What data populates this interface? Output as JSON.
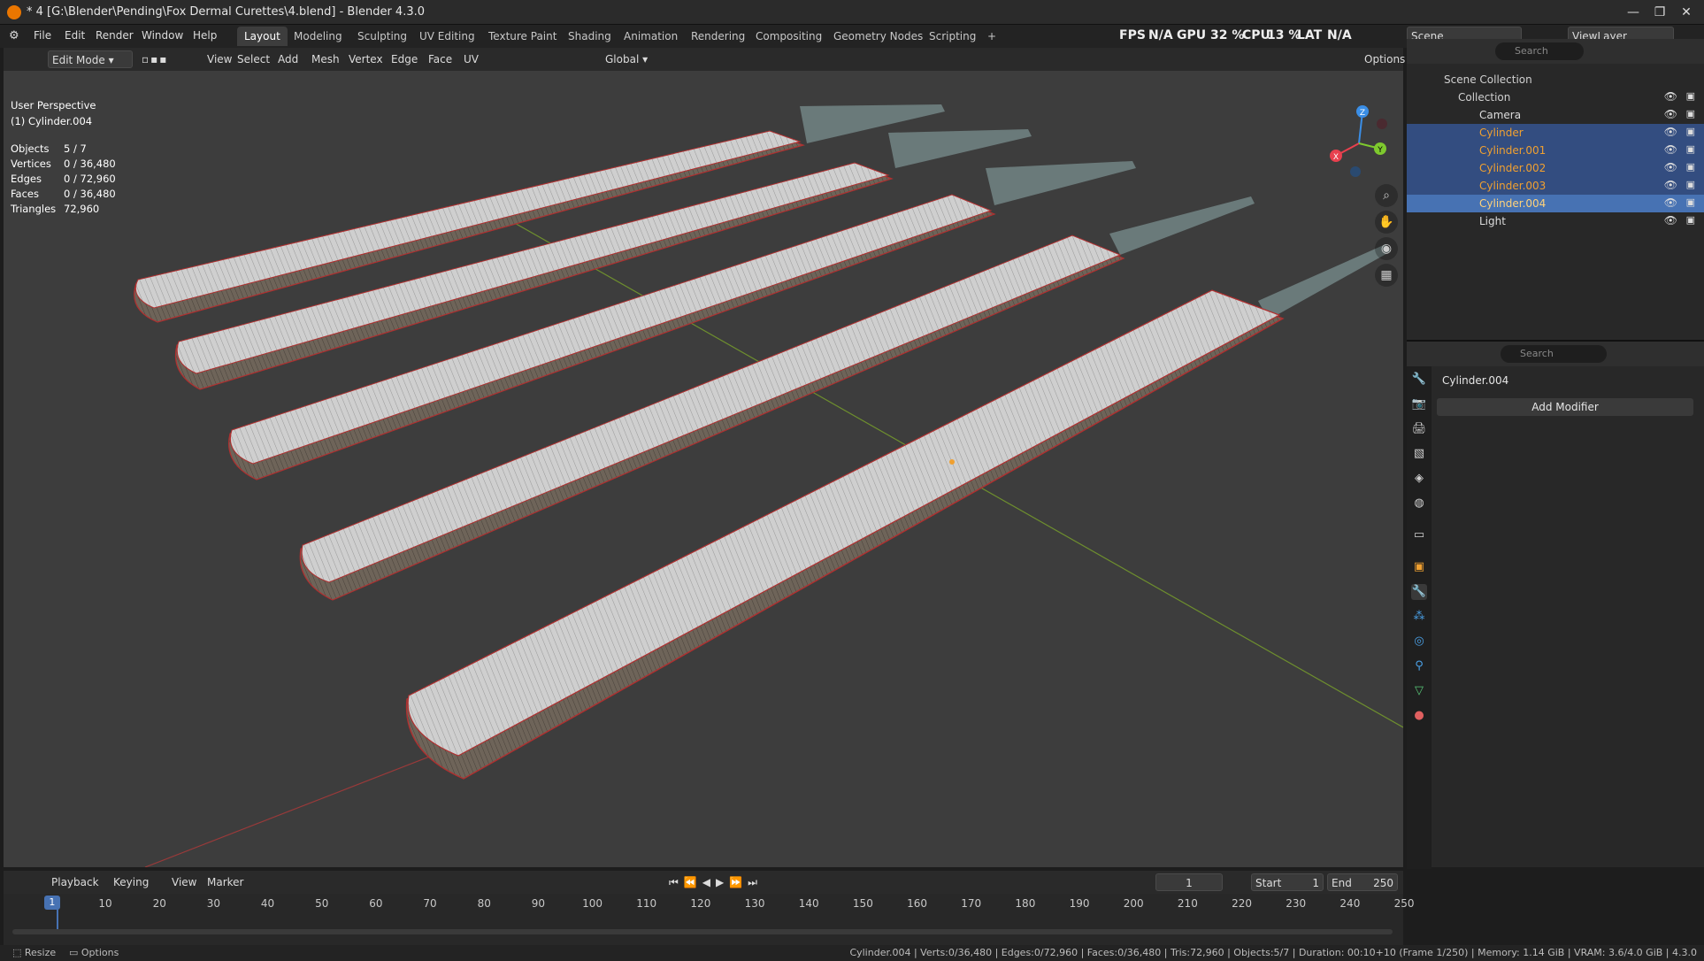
{
  "window": {
    "title": "* 4 [G:\\Blender\\Pending\\Fox Dermal Curettes\\4.blend] - Blender 4.3.0",
    "min": "—",
    "max": "❐",
    "close": "✕"
  },
  "menu": [
    "File",
    "Edit",
    "Render",
    "Window",
    "Help"
  ],
  "workspaces": [
    "Layout",
    "Modeling",
    "Sculpting",
    "UV Editing",
    "Texture Paint",
    "Shading",
    "Animation",
    "Rendering",
    "Compositing",
    "Geometry Nodes",
    "Scripting",
    "+"
  ],
  "stats_bar": {
    "fps_label": "FPS",
    "fps": "N/A",
    "gpu_label": "GPU",
    "gpu": "32 %",
    "cpu_label": "CPU",
    "cpu": "13 %",
    "lat_label": "LAT",
    "lat": "N/A"
  },
  "scene": {
    "label": "Scene",
    "viewlayer": "ViewLayer"
  },
  "viewport_header": {
    "mode": "Edit Mode",
    "menus": [
      "View",
      "Select",
      "Add",
      "Mesh",
      "Vertex",
      "Edge",
      "Face",
      "UV"
    ],
    "transform": "Global",
    "options": "Options",
    "axes": [
      "X",
      "Y",
      "Z"
    ]
  },
  "viewport_overlay": {
    "perspective": "User Perspective",
    "object": "(1) Cylinder.004",
    "stats": [
      {
        "k": "Objects",
        "v": "5 / 7"
      },
      {
        "k": "Vertices",
        "v": "0 / 36,480"
      },
      {
        "k": "Edges",
        "v": "0 / 72,960"
      },
      {
        "k": "Faces",
        "v": "0 / 36,480"
      },
      {
        "k": "Triangles",
        "v": "72,960"
      }
    ]
  },
  "gizmo": {
    "x": "X",
    "y": "Y",
    "z": "Z",
    "colors": {
      "x": "#e8404e",
      "y": "#7ec92e",
      "z": "#3a8ee6"
    }
  },
  "outliner": {
    "search_placeholder": "Search",
    "root": "Scene Collection",
    "collection": "Collection",
    "items": [
      {
        "name": "Camera",
        "color": "#dcdcdc",
        "state": "none"
      },
      {
        "name": "Cylinder",
        "color": "#f0a030",
        "state": "sel"
      },
      {
        "name": "Cylinder.001",
        "color": "#f0a030",
        "state": "sel"
      },
      {
        "name": "Cylinder.002",
        "color": "#f0a030",
        "state": "sel"
      },
      {
        "name": "Cylinder.003",
        "color": "#f0a030",
        "state": "sel"
      },
      {
        "name": "Cylinder.004",
        "color": "#ffd27a",
        "state": "act"
      },
      {
        "name": "Light",
        "color": "#dcdcdc",
        "state": "none"
      }
    ]
  },
  "properties": {
    "search_placeholder": "Search",
    "object": "Cylinder.004",
    "add_modifier": "Add Modifier"
  },
  "timeline": {
    "menus": [
      "Playback",
      "Keying",
      "View",
      "Marker"
    ],
    "current_frame": "1",
    "start_label": "Start",
    "start": "1",
    "end_label": "End",
    "end": "250",
    "ticks": [
      "10",
      "20",
      "30",
      "40",
      "50",
      "60",
      "70",
      "80",
      "90",
      "100",
      "110",
      "120",
      "130",
      "140",
      "150",
      "160",
      "170",
      "180",
      "190",
      "200",
      "210",
      "220",
      "230",
      "240",
      "250"
    ],
    "cursor_frame": "1"
  },
  "statusbar": {
    "left1": "Resize",
    "left2": "Options",
    "right": "Cylinder.004 | Verts:0/36,480 | Edges:0/72,960 | Faces:0/36,480 | Tris:72,960 | Objects:5/7 | Duration: 00:10+10 (Frame 1/250) | Memory: 1.14 GiB | VRAM: 3.6/4.0 GiB | 4.3.0"
  },
  "colors": {
    "accent": "#4772b3",
    "selected": "#334d80",
    "object_orange": "#f0a030",
    "edge_red": "#c0392b"
  }
}
